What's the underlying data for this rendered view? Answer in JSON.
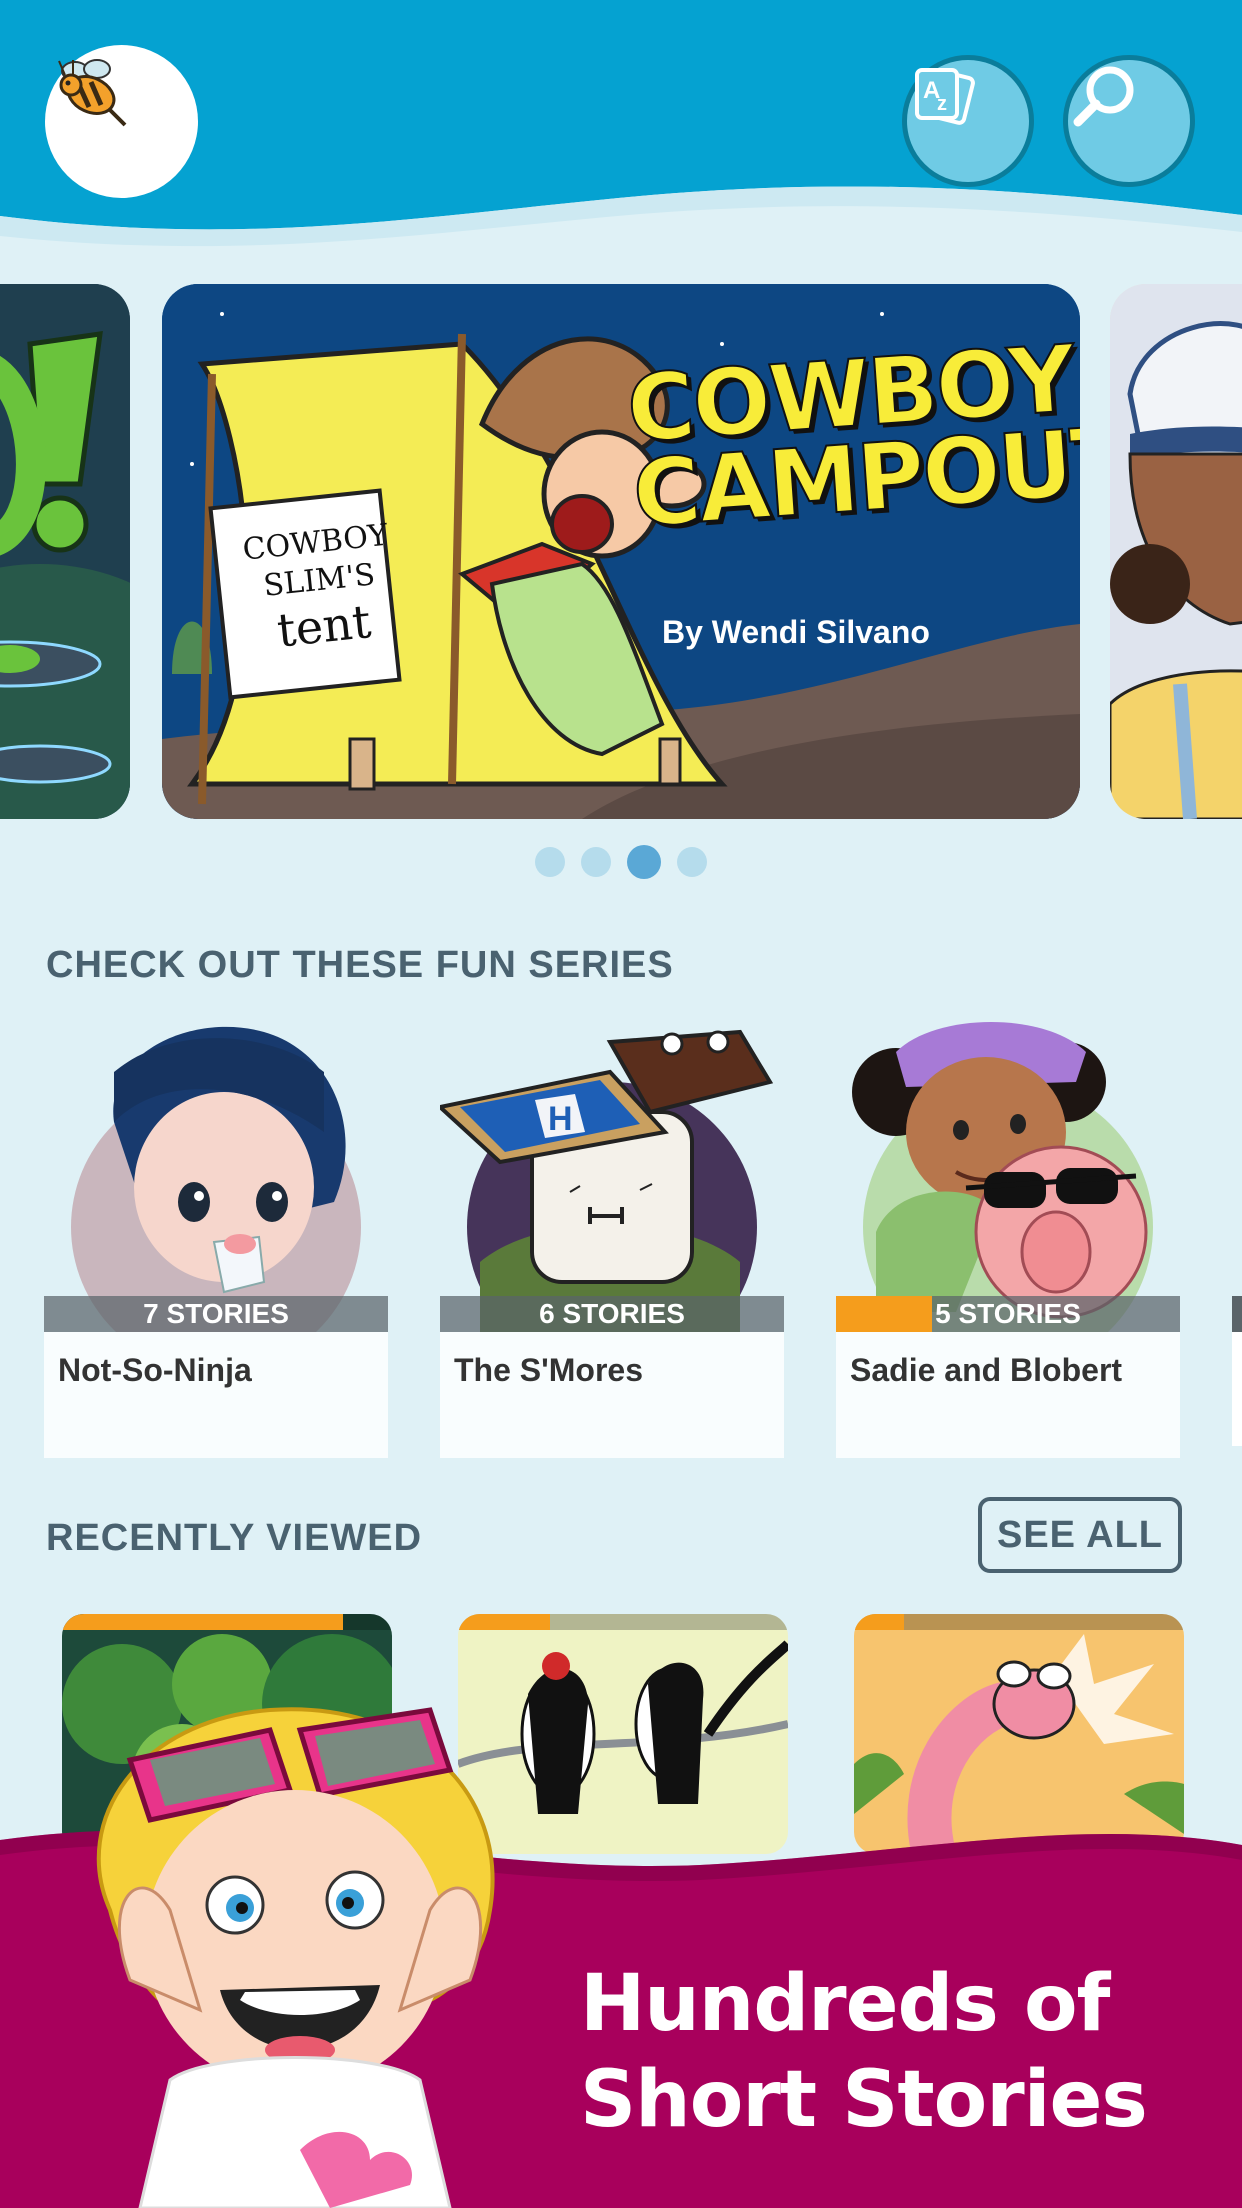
{
  "header": {
    "logo_icon": "bee-logo-icon",
    "az_icon": "az-cards-icon",
    "search_icon": "search-icon",
    "colors": {
      "header": "#06a3d2",
      "button_fill": "#6fcbe5",
      "button_border": "#0a7d9b"
    }
  },
  "carousel": {
    "featured": {
      "title_line1": "COWBOY",
      "title_line2": "CAMPOUT",
      "author": "By Wendi Silvano",
      "tent_sign_line1": "COWBOY",
      "tent_sign_line2": "SLIM'S",
      "tent_sign_line3": "tent"
    },
    "page_count": 4,
    "active_page": 3
  },
  "series_section": {
    "title": "CHECK OUT THESE FUN SERIES",
    "items": [
      {
        "name": "Not-So-Ninja",
        "count_label": "7 STORIES",
        "progress": 0
      },
      {
        "name": "The S'Mores",
        "count_label": "6 STORIES",
        "progress": 0
      },
      {
        "name": "Sadie and Blobert",
        "count_label": "5 STORIES",
        "progress": 0.28
      }
    ]
  },
  "recent_section": {
    "title": "RECENTLY VIEWED",
    "see_all_label": "SEE ALL",
    "items": [
      {
        "art": "jungle-cover",
        "progress": 0.85
      },
      {
        "art": "woodpeckers-cover",
        "progress": 0.28
      },
      {
        "art": "worm-cover",
        "progress": 0.15
      }
    ]
  },
  "promo": {
    "line1": "Hundreds of",
    "line2": "Short Stories",
    "color": "#a8005c"
  }
}
